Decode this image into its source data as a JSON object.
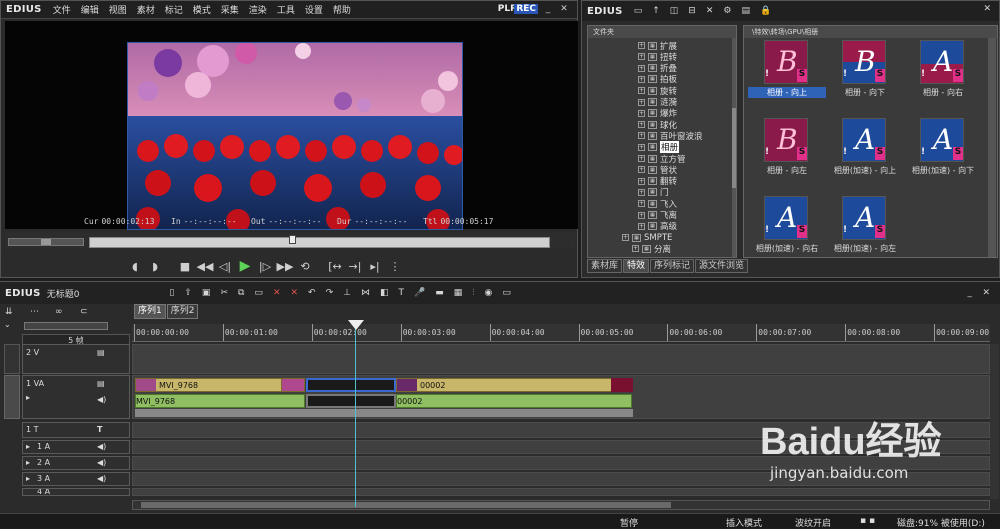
{
  "player": {
    "brand": "EDIUS",
    "menu": [
      "文件",
      "编辑",
      "视图",
      "素材",
      "标记",
      "模式",
      "采集",
      "渲染",
      "工具",
      "设置",
      "帮助"
    ],
    "plr": "PLR",
    "rec": "REC",
    "timecodes": {
      "cur_label": "Cur",
      "cur": "00:00:02:13",
      "in_label": "In",
      "in": "--:--:--:--",
      "out_label": "Out",
      "out": "--:--:--:--",
      "dur_label": "Dur",
      "dur": "--:--:--:--",
      "ttl_label": "Ttl",
      "ttl": "00:00:05:17"
    }
  },
  "bin": {
    "brand": "EDIUS",
    "tree_header": "文件夹",
    "tree_items": [
      "扩展",
      "扭转",
      "折叠",
      "拍板",
      "旋转",
      "涟漪",
      "爆炸",
      "球化",
      "百叶窗波浪",
      "相册",
      "立方管",
      "管状",
      "翻转",
      "门",
      "飞入",
      "飞离",
      "高级",
      "SMPTE",
      "分离"
    ],
    "selected_tree_item": "相册",
    "grid_header": "\\特效\\转场\\GPU\\相册",
    "thumbnails": [
      {
        "label": "相册 - 向上",
        "letter": "B",
        "variant": "red",
        "selected": true
      },
      {
        "label": "相册 - 向下",
        "letter": "B",
        "variant": "redsplit",
        "selected": false
      },
      {
        "label": "相册 - 向右",
        "letter": "A",
        "variant": "bluesplit",
        "selected": false
      },
      {
        "label": "相册 - 向左",
        "letter": "B",
        "variant": "red",
        "selected": false
      },
      {
        "label": "相册(加速) - 向上",
        "letter": "A",
        "variant": "blue",
        "selected": false
      },
      {
        "label": "相册(加速) - 向下",
        "letter": "A",
        "variant": "blue",
        "selected": false
      },
      {
        "label": "相册(加速) - 向右",
        "letter": "A",
        "variant": "blue",
        "selected": false
      },
      {
        "label": "相册(加速) - 向左",
        "letter": "A",
        "variant": "blue",
        "selected": false
      }
    ],
    "tabs": [
      "素材库",
      "特效",
      "序列标记",
      "源文件浏览"
    ],
    "active_tab": "特效"
  },
  "timeline": {
    "brand": "EDIUS",
    "project": "无标题0",
    "sequences": [
      "序列1",
      "序列2"
    ],
    "zoom_label": "5 帧",
    "ruler_ticks": [
      "00:00:00:00",
      "00:00:01:00",
      "00:00:02:00",
      "00:00:03:00",
      "00:00:04:00",
      "00:00:05:00",
      "00:00:06:00",
      "00:00:07:00",
      "00:00:08:00",
      "00:00:09:00"
    ],
    "tracks": [
      {
        "id": "2 V"
      },
      {
        "id": "1 VA"
      },
      {
        "id": "1 T"
      },
      {
        "id": "1 A"
      },
      {
        "id": "2 A"
      },
      {
        "id": "3 A"
      },
      {
        "id": "4 A"
      }
    ],
    "clips": {
      "video_a_name": "MVI_9768",
      "video_b_name": "00002",
      "audio_a_name": "MVI_9768",
      "audio_b_name": "00002"
    }
  },
  "status": {
    "pause": "暂停",
    "insert_mode": "插入模式",
    "ripple": "波纹开启",
    "disk": "磁盘:91% 被使用(D:)"
  },
  "watermark": {
    "text": "Baidu经验",
    "url": "jingyan.baidu.com"
  }
}
